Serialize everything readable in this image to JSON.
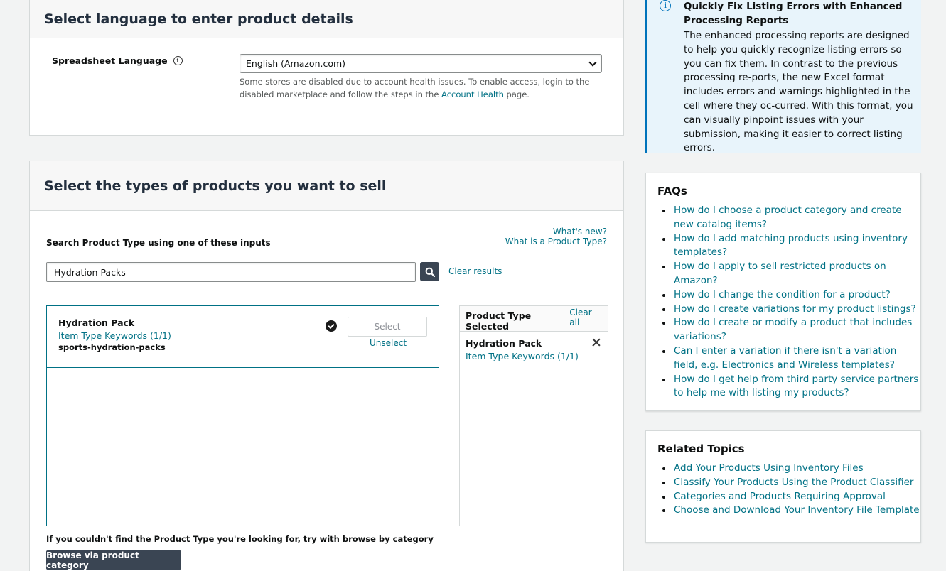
{
  "language_panel": {
    "title": "Select language to enter product details",
    "label": "Spreadsheet Language",
    "selected": "English (Amazon.com)",
    "note_before": "Some stores are disabled due to account health issues. To enable access, login to the disabled marketplace and follow the steps in the ",
    "note_link": "Account Health",
    "note_after": " page."
  },
  "types_panel": {
    "title": "Select the types of products you want to sell",
    "whats_new": "What's new?",
    "what_is": "What is a Product Type?",
    "search_label": "Search Product Type using one of these inputs",
    "search_value": "Hydration Packs",
    "clear_results": "Clear results",
    "result": {
      "title": "Hydration Pack",
      "keywords": "Item Type Keywords (1/1)",
      "code": "sports-hydration-packs",
      "select_label": "Select",
      "unselect_label": "Unselect"
    },
    "selected_panel": {
      "title": "Product Type Selected",
      "clear_all": "Clear all",
      "item_title": "Hydration Pack",
      "item_keywords": "Item Type Keywords (1/1)"
    },
    "browse_text": "If you couldn't find the Product Type you're looking for, try with browse by category",
    "browse_button": "Browse via product category"
  },
  "alert": {
    "title": "Quickly Fix Listing Errors with Enhanced Processing Reports",
    "body": "The enhanced processing reports are designed to help you quickly recognize listing errors so you can fix them. In contrast to the previous processing re-ports, the new Excel format includes errors and warnings highlighted in the cell where they oc-curred. With this format, you can visually pinpoint issues with your submission, making it easier to correct listing errors."
  },
  "faqs": {
    "title": "FAQs",
    "items": [
      "How do I choose a product category and create new catalog items?",
      "How do I add matching products using inventory templates?",
      "How do I apply to sell restricted products on Amazon?",
      "How do I change the condition for a product?",
      "How do I create variations for my product listings?",
      "How do I create or modify a product that includes variations?",
      "Can I enter a variation if there isn't a variation field, e.g. Electronics and Wireless templates?",
      "How do I get help from third party service partners to help me with listing my products?"
    ]
  },
  "related": {
    "title": "Related Topics",
    "items": [
      "Add Your Products Using Inventory Files",
      "Classify Your Products Using the Product Classifier",
      "Categories and Products Requiring Approval",
      "Choose and Download Your Inventory File Template"
    ]
  },
  "colors": {
    "link": "#007185",
    "dark_button": "#3a4553",
    "info_blue": "#0073bb",
    "alert_bg": "#e8f4fb"
  },
  "icons": [
    "info-icon",
    "chevron-down-icon",
    "search-icon",
    "check-circle-icon",
    "close-icon"
  ]
}
